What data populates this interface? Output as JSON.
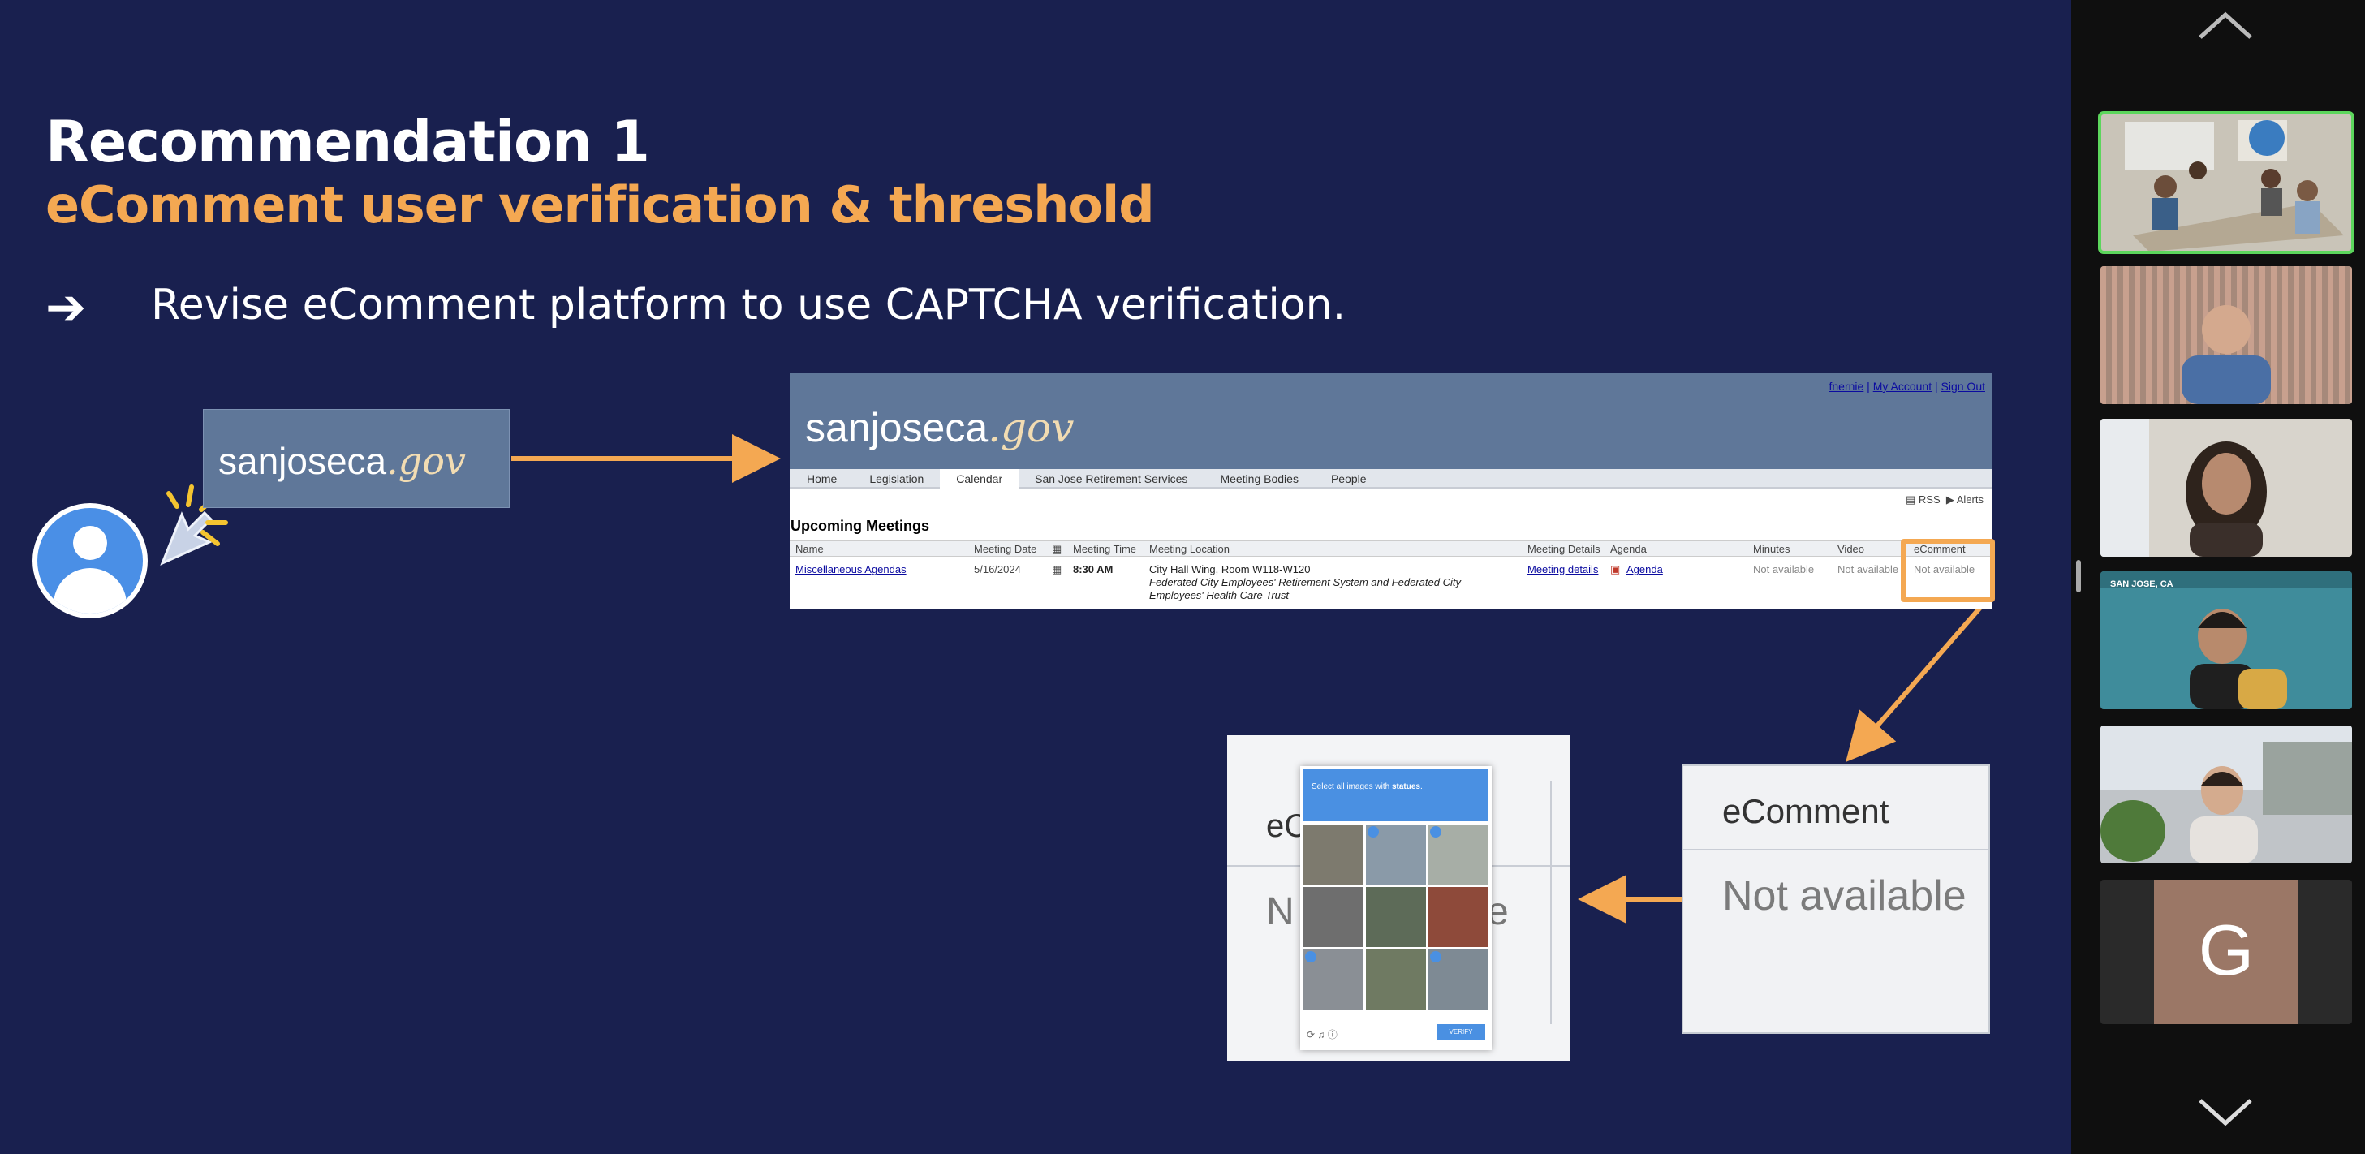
{
  "slide": {
    "title": "Recommendation 1",
    "subtitle": "eComment user verification & threshold",
    "bullet_marker": "➔",
    "bullet": "Revise eComment platform to use CAPTCHA verification."
  },
  "logo": {
    "name": "sanjoseca",
    "suffix": ".gov"
  },
  "site": {
    "top_links": [
      "fnernie",
      "My Account",
      "Sign Out"
    ],
    "nav_tabs": [
      "Home",
      "Legislation",
      "Calendar",
      "San Jose Retirement Services",
      "Meeting Bodies",
      "People"
    ],
    "active_tab": "Calendar",
    "rss": "RSS",
    "alerts": "Alerts",
    "section_title": "Upcoming Meetings",
    "columns": [
      "Name",
      "Meeting Date",
      "Meeting Time",
      "Meeting Location",
      "Meeting Details",
      "Agenda",
      "Minutes",
      "Video",
      "eComment"
    ],
    "row": {
      "name": "Miscellaneous Agendas",
      "date": "5/16/2024",
      "time": "8:30 AM",
      "location_1": "City Hall Wing, Room W118-W120",
      "location_2": "Federated City Employees' Retirement System and Federated City",
      "location_3": "Employees' Health Care Trust",
      "details": "Meeting details",
      "agenda": "Agenda",
      "minutes": "Not available",
      "video": "Not available",
      "ecomment": "Not available"
    }
  },
  "zoom_panel": {
    "heading": "eComment",
    "value": "Not available"
  },
  "captcha": {
    "instruction_prefix": "Select all images with ",
    "instruction_keyword": "statues",
    "verify": "VERIFY",
    "ghost_heading": "eC",
    "ghost_left": "N",
    "ghost_right": "e",
    "tiles": [
      {
        "checked": false,
        "color": "#7d7a6e"
      },
      {
        "checked": true,
        "color": "#8a9aa8"
      },
      {
        "checked": true,
        "color": "#a7aea6"
      },
      {
        "checked": false,
        "color": "#6e6e6e"
      },
      {
        "checked": false,
        "color": "#5d6b58"
      },
      {
        "checked": false,
        "color": "#8e4a3a"
      },
      {
        "checked": true,
        "color": "#8a8f95"
      },
      {
        "checked": false,
        "color": "#6f7a62"
      },
      {
        "checked": true,
        "color": "#7e8a94"
      }
    ]
  },
  "participants": {
    "location_label": "SAN JOSE, CA",
    "initial": "G",
    "tile_colors": [
      "#c9c4b8",
      "#a6897a",
      "#d8d4cc",
      "#3f8c9b",
      "#c0c4c8"
    ]
  },
  "colors": {
    "background": "#19204f",
    "accent": "#f4a852",
    "header": "#5f7799"
  }
}
